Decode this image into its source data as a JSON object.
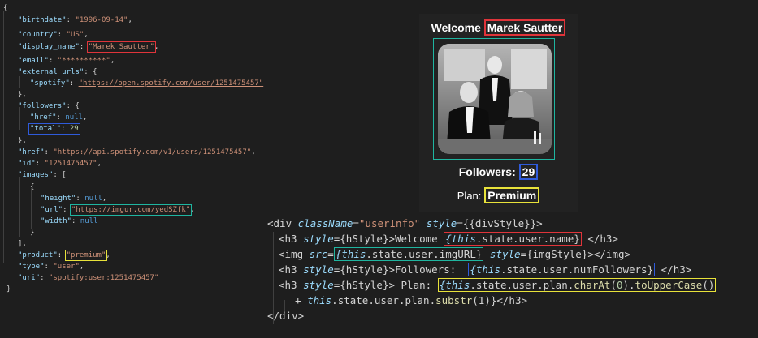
{
  "json_doc": {
    "open_brace": "{",
    "birthdate_key": "\"birthdate\"",
    "birthdate_val": "\"1996-09-14\"",
    "country_key": "\"country\"",
    "country_val": "\"US\"",
    "display_name_key": "\"display_name\"",
    "display_name_val": "\"Marek Sautter\"",
    "email_key": "\"email\"",
    "email_val": "\"**********\"",
    "external_urls_key": "\"external_urls\"",
    "spotify_key": "\"spotify\"",
    "spotify_val": "\"https://open.spotify.com/user/1251475457\"",
    "followers_key": "\"followers\"",
    "href_key": "\"href\"",
    "null_val": "null",
    "total_key": "\"total\"",
    "total_val": "29",
    "href2_key": "\"href\"",
    "href2_val": "\"https://api.spotify.com/v1/users/1251475457\"",
    "id_key": "\"id\"",
    "id_val": "\"1251475457\"",
    "images_key": "\"images\"",
    "height_key": "\"height\"",
    "url_key": "\"url\"",
    "url_val": "\"https://imgur.com/yedSZfk\"",
    "width_key": "\"width\"",
    "product_key": "\"product\"",
    "product_val": "\"premium\"",
    "type_key": "\"type\"",
    "type_val": "\"user\"",
    "uri_key": "\"uri\"",
    "uri_val": "\"spotify:user:1251475457\"",
    "close_brace": "}"
  },
  "preview": {
    "welcome_label": "Welcome",
    "user_name": "Marek Sautter",
    "followers_label": "Followers:",
    "followers_count": "29",
    "plan_label": "Plan:",
    "plan_value": "Premium"
  },
  "code": {
    "line1": {
      "open": "<div ",
      "attr1": "className",
      "eq1": "=",
      "val1": "\"userInfo\"",
      "sp": " ",
      "attr2": "style",
      "eq2": "={{divStyle}}>"
    },
    "line2": {
      "open": "<h3 ",
      "attr": "style",
      "rest": "={hStyle}>Welcome ",
      "expr_this": "{this",
      "expr_rest": ".state.user.name}",
      "close": " </h3>"
    },
    "line3": {
      "open": "<img ",
      "attr": "src",
      "eq": "=",
      "expr_this": "{this",
      "expr_rest": ".state.user.imgURL}",
      "sp": " ",
      "attr2": "style",
      "rest": "={imgStyle}></img>"
    },
    "line4": {
      "open": "<h3 ",
      "attr": "style",
      "rest": "={hStyle}>Followers:  ",
      "expr_this": "{this",
      "expr_rest": ".state.user.numFollowers}",
      "close": " </h3>"
    },
    "line5": {
      "open": "<h3 ",
      "attr": "style",
      "rest": "={hStyle}> Plan: ",
      "expr_this": "{this",
      "expr_mid": ".state.user.plan.",
      "fn1": "charAt",
      "p1": "(",
      "num": "0",
      "p2": ").",
      "fn2": "toUpperCase",
      "p3": "()"
    },
    "line6": {
      "plus": "+ ",
      "expr_this": "this",
      "expr_mid": ".state.user.plan.",
      "fn": "substr",
      "rest": "(1)}</h3>"
    },
    "line7": {
      "close": "</div>"
    }
  },
  "colors": {
    "background": "#1e1e1e",
    "highlight_red": "#e0343a",
    "highlight_blue": "#2f5bdb",
    "highlight_teal": "#1fb5a0",
    "highlight_yellow": "#e8e23a"
  }
}
